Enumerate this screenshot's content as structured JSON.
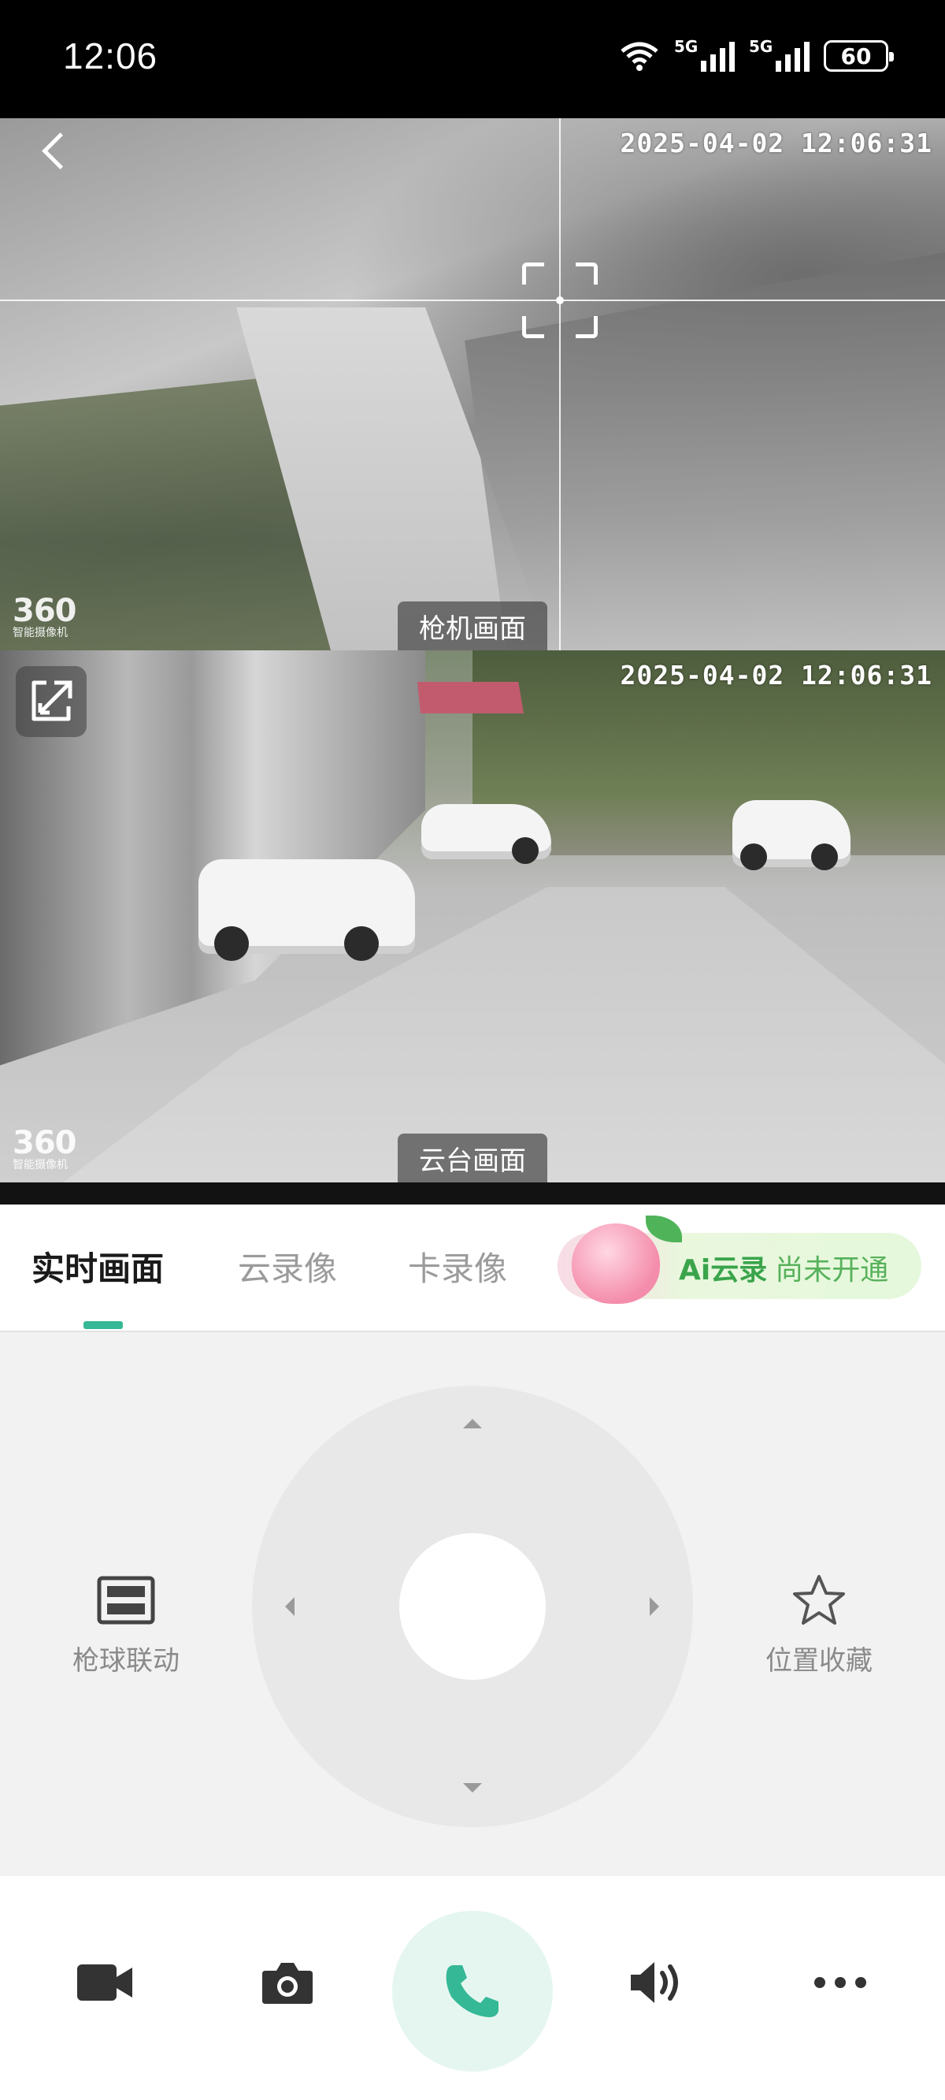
{
  "status_bar": {
    "time": "12:06",
    "network_1": "5G",
    "network_2": "5G",
    "battery": "60"
  },
  "video": {
    "timestamp_top": "2025-04-02 12:06:31",
    "timestamp_bottom": "2025-04-02 12:06:31",
    "watermark_number": "360",
    "watermark_text": "智能摄像机",
    "top_label": "枪机画面",
    "bottom_label": "云台画面"
  },
  "tabs": [
    {
      "label": "实时画面",
      "active": true
    },
    {
      "label": "云录像",
      "active": false
    },
    {
      "label": "卡录像",
      "active": false
    }
  ],
  "ai_banner": {
    "title": "Ai云录",
    "status": "尚未开通"
  },
  "controls": {
    "left_action": "枪球联动",
    "right_action": "位置收藏"
  },
  "toolbar": {
    "icons": [
      "video-record-icon",
      "camera-icon",
      "phone-icon",
      "speaker-icon",
      "more-icon"
    ]
  },
  "colors": {
    "accent": "#35b896",
    "call_bg": "#e5f6f0",
    "ai_green": "#3aa44b"
  }
}
